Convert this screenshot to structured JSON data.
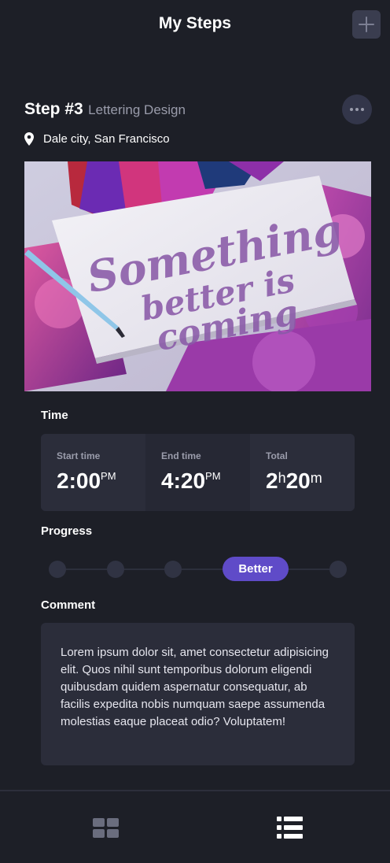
{
  "header": {
    "title": "My Steps",
    "add_icon": "plus-icon"
  },
  "step": {
    "number": "Step #3",
    "name": "Lettering Design",
    "more_icon": "more-horizontal-icon",
    "location_icon": "map-pin-icon",
    "location": "Dale city, San Francisco",
    "photo": {
      "lettering_lines": [
        "Something",
        "better is",
        "coming"
      ]
    }
  },
  "time": {
    "label": "Time",
    "start_label": "Start time",
    "start_value": "2:00",
    "start_suffix": "PM",
    "end_label": "End time",
    "end_value": "4:20",
    "end_suffix": "PM",
    "total_label": "Total",
    "total_hours": "2",
    "total_hours_unit": "h",
    "total_minutes": "20",
    "total_minutes_unit": "m"
  },
  "progress": {
    "label": "Progress",
    "steps": 5,
    "current_index": 3,
    "current_label": "Better",
    "accent_color": "#5f4bc8"
  },
  "comment": {
    "label": "Comment",
    "text": "Lorem ipsum dolor sit, amet consectetur adipisicing elit. Quos nihil sunt temporibus dolorum eligendi quibusdam quidem aspernatur consequatur, ab facilis expedita nobis numquam saepe assumenda molestias eaque placeat odio? Voluptatem!"
  },
  "nav": {
    "grid_icon": "grid-view-icon",
    "list_icon": "list-view-icon"
  }
}
